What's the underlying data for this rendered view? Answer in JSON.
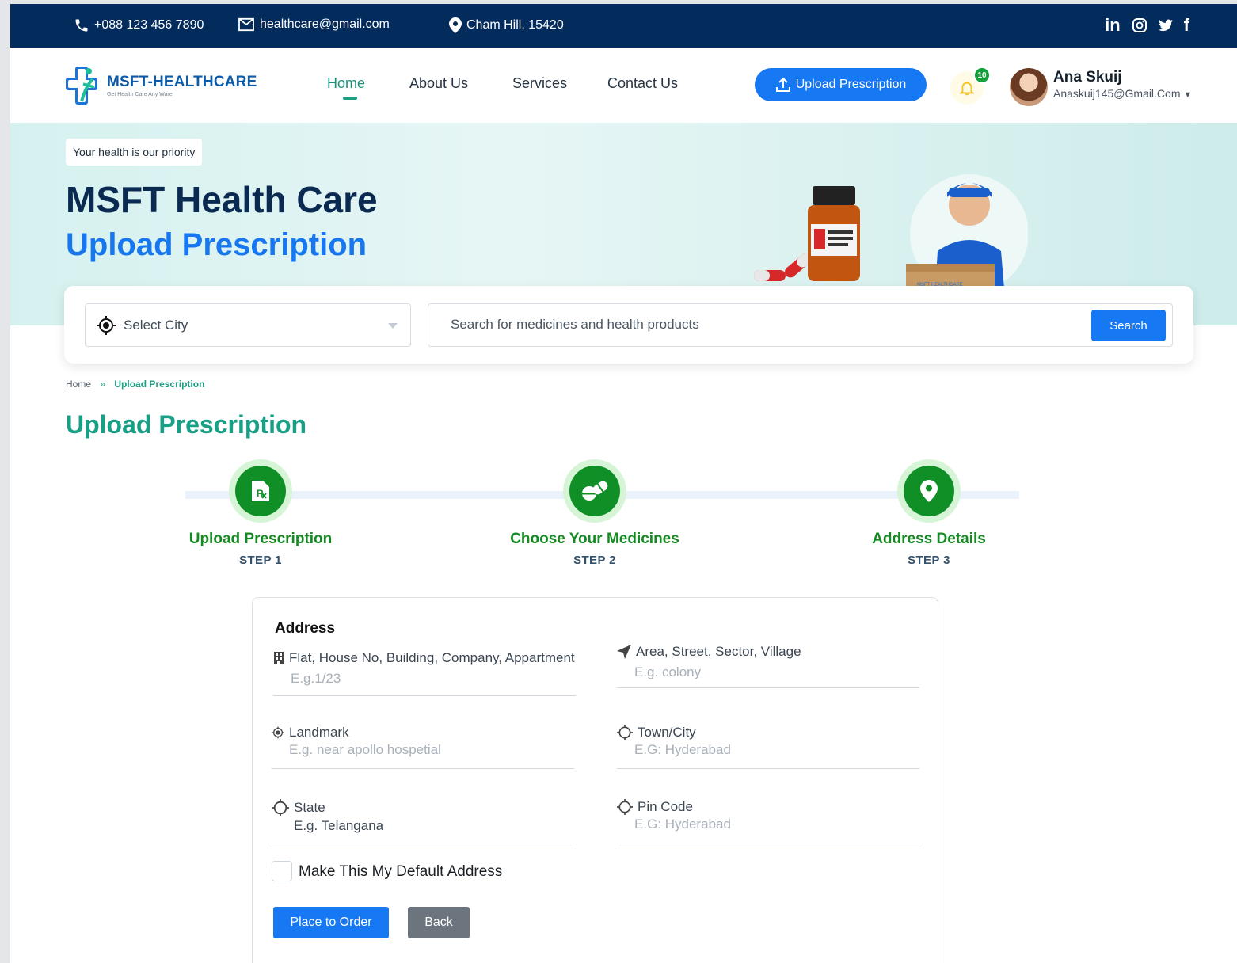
{
  "topbar": {
    "phone": "+088 123 456 7890",
    "email": "healthcare@gmail.com",
    "location": "Cham Hill, 15420",
    "social": [
      "linkedin-icon",
      "instagram-icon",
      "twitter-icon",
      "facebook-icon"
    ]
  },
  "brand": {
    "name": "MSFT-HEALTHCARE",
    "tagline": "Get Health Care Any Ware",
    "accent": "#1678f2",
    "green": "#0f8f25",
    "teal": "#17a085",
    "navy": "#032b5b"
  },
  "nav": {
    "items": [
      {
        "label": "Home",
        "active": true
      },
      {
        "label": "About Us"
      },
      {
        "label": "Services"
      },
      {
        "label": "Contact Us"
      }
    ],
    "upload_button": "Upload Prescription",
    "notification_count": "10",
    "user_name": "Ana Skuij",
    "user_email": "Anaskuij145@Gmail.Com"
  },
  "hero": {
    "tag": "Your health is our priority",
    "title": "MSFT Health Care",
    "subtitle": "Upload Prescription",
    "box_label": "MSFT HEALTHCARE"
  },
  "search": {
    "city_placeholder": "Select City",
    "query_placeholder": "Search for medicines and health products",
    "button": "Search"
  },
  "breadcrumb": {
    "home": "Home",
    "separator": "»",
    "current": "Upload Prescription"
  },
  "page_title": "Upload Prescription",
  "steps": [
    {
      "label": "Upload Prescription",
      "step": "STEP 1",
      "icon": "prescription-icon"
    },
    {
      "label": "Choose Your Medicines",
      "step": "STEP 2",
      "icon": "pills-icon"
    },
    {
      "label": "Address Details",
      "step": "STEP 3",
      "icon": "location-pin-icon"
    }
  ],
  "form": {
    "heading": "Address",
    "fields": {
      "flat": {
        "label": "Flat, House No, Building, Company, Appartment",
        "placeholder": "E.g.1/23"
      },
      "area": {
        "label": "Area, Street, Sector, Village",
        "placeholder": "E.g. colony"
      },
      "landmark": {
        "label": "Landmark",
        "placeholder": "E.g. near apollo hospetial"
      },
      "town": {
        "label": "Town/City",
        "placeholder": "E.G: Hyderabad"
      },
      "state": {
        "label": "State",
        "placeholder": "E.g. Telangana"
      },
      "pincode": {
        "label": "Pin Code",
        "placeholder": "E.G: Hyderabad"
      }
    },
    "default_checkbox": "Make This My Default Address",
    "default_checked": false,
    "submit": "Place to Order",
    "back": "Back"
  }
}
